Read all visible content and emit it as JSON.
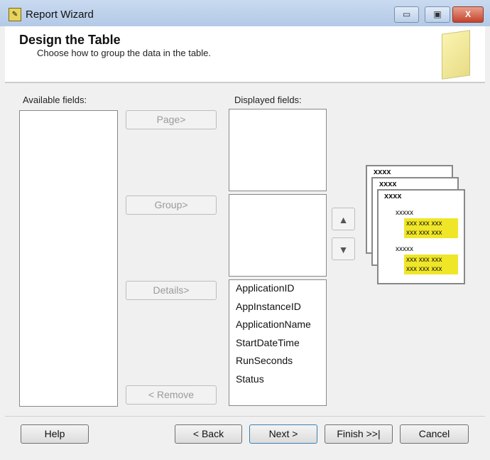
{
  "window": {
    "title": "Report Wizard",
    "minimize": "▭",
    "maximize": "▣",
    "close": "X"
  },
  "header": {
    "title": "Design the Table",
    "subtitle": "Choose how to group the data in the table."
  },
  "available": {
    "label": "Available fields:",
    "items": []
  },
  "buttons": {
    "page": "Page>",
    "group": "Group>",
    "details": "Details>",
    "remove": "< Remove"
  },
  "displayed": {
    "label": "Displayed fields:",
    "page_items": [],
    "group_items": [],
    "details_items": [
      "ApplicationID",
      "AppInstanceID",
      "ApplicationName",
      "StartDateTime",
      "RunSeconds",
      "Status"
    ]
  },
  "preview": {
    "page_header": "xxxx",
    "group_header": "xxxxx",
    "detail_row": "xxx xxx xxx"
  },
  "footer": {
    "help": "Help",
    "back": "< Back",
    "next": "Next >",
    "finish": "Finish >>|",
    "cancel": "Cancel"
  }
}
